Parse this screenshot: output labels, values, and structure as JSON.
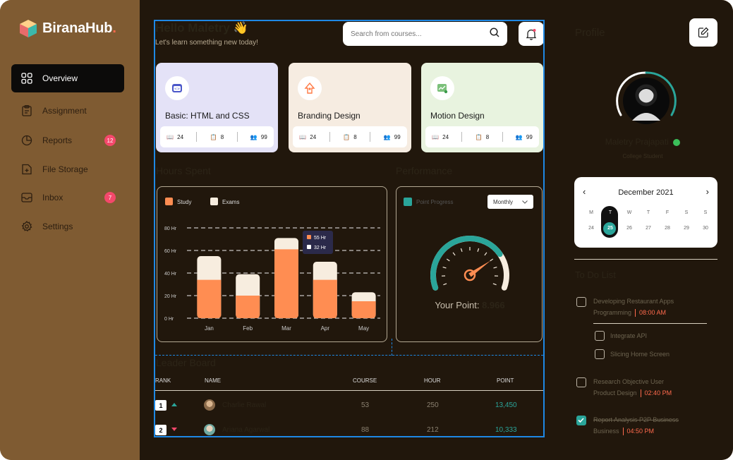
{
  "brand": {
    "name": "BiranaHub",
    "dot": "."
  },
  "sidebar": {
    "items": [
      {
        "label": "Overview",
        "icon": "grid-icon",
        "badge": null
      },
      {
        "label": "Assignment",
        "icon": "clipboard-icon",
        "badge": null
      },
      {
        "label": "Reports",
        "icon": "pie-chart-icon",
        "badge": "12"
      },
      {
        "label": "File Storage",
        "icon": "file-plus-icon",
        "badge": null
      },
      {
        "label": "Inbox",
        "icon": "inbox-icon",
        "badge": "7"
      },
      {
        "label": "Settings",
        "icon": "gear-icon",
        "badge": null
      }
    ]
  },
  "header": {
    "greeting": "Hello Maletry 👋",
    "subtitle": "Let's learn something new today!",
    "search_placeholder": "Search from courses..."
  },
  "courses": [
    {
      "title": "Basic: HTML and CSS",
      "lessons": "24",
      "assignments": "8",
      "students": "99",
      "bg": "#e4e2f7",
      "icon": "code-icon"
    },
    {
      "title": "Branding Design",
      "lessons": "24",
      "assignments": "8",
      "students": "99",
      "bg": "#f6ece1",
      "icon": "rocket-icon"
    },
    {
      "title": "Motion Design",
      "lessons": "24",
      "assignments": "8",
      "students": "99",
      "bg": "#e8f3df",
      "icon": "chart-image-icon"
    }
  ],
  "hours_spent": {
    "title": "Hours Spent",
    "legend": [
      "Study",
      "Exams"
    ],
    "tooltip": {
      "exams": "55 Hr",
      "study": "32 Hr"
    }
  },
  "chart_data": {
    "type": "bar",
    "categories": [
      "Jan",
      "Feb",
      "Mar",
      "Apr",
      "May"
    ],
    "series": [
      {
        "name": "Study",
        "values": [
          34,
          20,
          61,
          34,
          15
        ]
      },
      {
        "name": "Exams",
        "values": [
          21,
          19,
          10,
          16,
          8
        ]
      }
    ],
    "stacked": true,
    "ylim": [
      0,
      80
    ],
    "yticks": [
      "0 Hr",
      "20 Hr",
      "40 Hr",
      "60 Hr",
      "80 Hr"
    ],
    "colors": [
      "#ff8d52",
      "#f7eddf"
    ]
  },
  "performance": {
    "title": "Performance",
    "legend": "Point Progress",
    "period": "Monthly",
    "point_label": "Your Point:",
    "point_value": "8.966",
    "progress": 0.75
  },
  "leaderboard": {
    "title": "Leader Board",
    "headers": [
      "RANK",
      "NAME",
      "COURSE",
      "HOUR",
      "POINT"
    ],
    "rows": [
      {
        "rank": "1",
        "trend": "up",
        "name": "Charlie Rawal",
        "course": "53",
        "hour": "250",
        "point": "13,450"
      },
      {
        "rank": "2",
        "trend": "down",
        "name": "Ariana Agarwal",
        "course": "88",
        "hour": "212",
        "point": "10,333"
      }
    ]
  },
  "profile": {
    "title": "Profile",
    "name": "Maletry Prajapati",
    "role": "College Student"
  },
  "calendar": {
    "month": "December 2021",
    "days": [
      "M",
      "T",
      "W",
      "T",
      "F",
      "S",
      "S"
    ],
    "dates": [
      "24",
      "25",
      "26",
      "27",
      "28",
      "29",
      "30"
    ],
    "selected_index": 1
  },
  "todo": {
    "title": "To Do List",
    "items": [
      {
        "line1": "Developing Restaurant Apps",
        "line2": "Programming",
        "time": "08:00 AM",
        "checked": false
      },
      {
        "sub": "Integrate API",
        "checked": false
      },
      {
        "sub": "Slicing Home Screen",
        "checked": false
      },
      {
        "line1": "Research Objective User",
        "line2": "Product Design",
        "time": "02:40 PM",
        "checked": false
      },
      {
        "line1": "Report Analysis P2P Business",
        "line2": "Business",
        "time": "04:50 PM",
        "checked": true
      }
    ]
  }
}
